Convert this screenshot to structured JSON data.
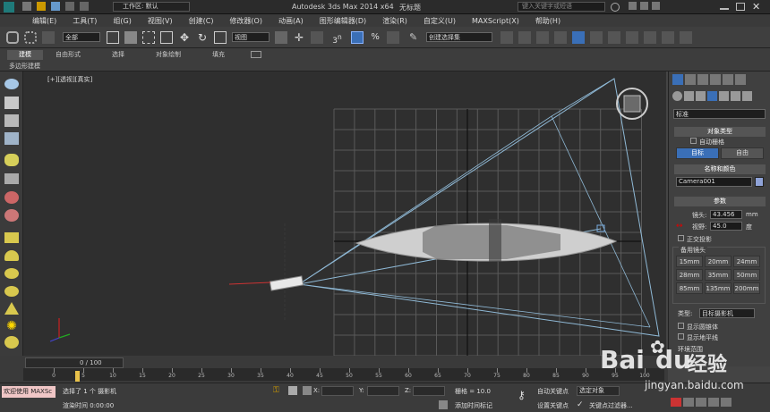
{
  "title": {
    "workspace_label": "工作区: 默认",
    "app": "Autodesk 3ds Max  2014 x64",
    "doc": "无标题",
    "search_placeholder": "键入关键字或短语"
  },
  "menu": [
    "编辑(E)",
    "工具(T)",
    "组(G)",
    "视图(V)",
    "创建(C)",
    "修改器(O)",
    "动画(A)",
    "图形编辑器(D)",
    "渲染(R)",
    "自定义(U)",
    "MAXScript(X)",
    "帮助(H)"
  ],
  "toolbar": {
    "filter": "全部",
    "coord": "视图",
    "selset": "创建选择集",
    "snap_n": "3",
    "snap_n_suffix": "n"
  },
  "ribbon": {
    "tabs": [
      "建模",
      "自由形式",
      "选择",
      "对象绘制",
      "填充"
    ],
    "sublabel": "多边形建模"
  },
  "viewport": {
    "label_parts": [
      "[+]",
      "[透视]",
      "[真实]"
    ]
  },
  "panel": {
    "dropdown": "标准",
    "obj_type": "对象类型",
    "autogrid": "自动栅格",
    "btn_target": "目标",
    "btn_free": "自由",
    "name_color": "名称和颜色",
    "name": "Camera001",
    "color": "#8fa3d8",
    "params": "参数",
    "lens_label": "镜头:",
    "lens_value": "43.456",
    "lens_unit": "mm",
    "fov_label": "视野:",
    "fov_value": "45.0",
    "fov_unit": "度",
    "ortho": "正交投影",
    "stock": "备用镜头",
    "lenses": [
      "15mm",
      "20mm",
      "24mm",
      "28mm",
      "35mm",
      "50mm",
      "85mm",
      "135mm",
      "200mm"
    ],
    "type_label": "类型:",
    "type_value": "目标摄影机",
    "show_cone": "显示圆锥体",
    "show_horizon": "显示地平线",
    "env_range": "环境范围"
  },
  "timeline": {
    "frame": "0 / 100",
    "ticks": [
      "0",
      "5",
      "10",
      "15",
      "20",
      "25",
      "30",
      "35",
      "40",
      "45",
      "50",
      "55",
      "60",
      "65",
      "70",
      "75",
      "80",
      "85",
      "90",
      "95",
      "100"
    ]
  },
  "status": {
    "welcome": "欢迎使用 MAXSc",
    "selected": "选择了 1 个 摄影机",
    "render_time": "渲染时间 0:00:00",
    "x_label": "X:",
    "y_label": "Y:",
    "z_label": "Z:",
    "grid": "栅格 = 10.0",
    "add_tag": "添加时间标记",
    "autokey": "自动关键点",
    "selected_obj": "选定对象",
    "setkey": "设置关键点",
    "key_filter": "关键点过滤器..."
  },
  "watermark": {
    "brand": "Bai",
    "brand2": "du",
    "cn": "经验",
    "url": "jingyan.baidu.com"
  }
}
